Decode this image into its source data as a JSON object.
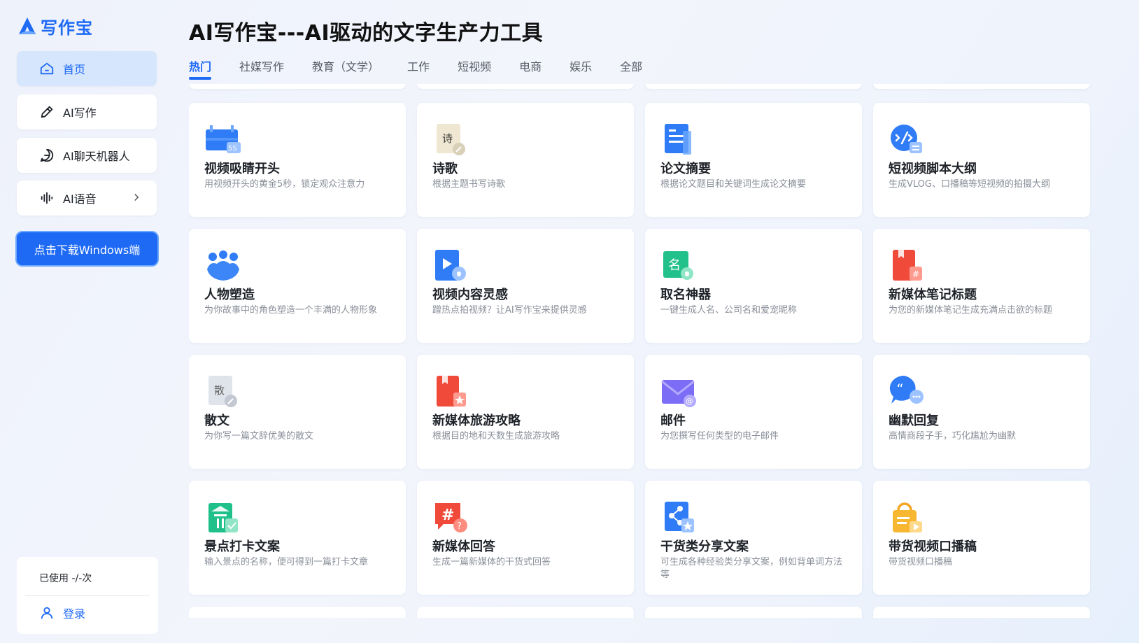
{
  "app": {
    "logo_text": "写作宝"
  },
  "sidebar": {
    "items": [
      {
        "label": "首页",
        "icon": "home-icon"
      },
      {
        "label": "AI写作",
        "icon": "pen-icon"
      },
      {
        "label": "AI聊天机器人",
        "icon": "chat-icon"
      },
      {
        "label": "AI语音",
        "icon": "audio-wave-icon"
      }
    ],
    "download_label": "点击下载Windows端",
    "usage_text": "已使用 -/-次",
    "login_label": "登录"
  },
  "header": {
    "title": "AI写作宝---AI驱动的文字生产力工具",
    "tabs": [
      "热门",
      "社媒写作",
      "教育（文学）",
      "工作",
      "短视频",
      "电商",
      "娱乐",
      "全部"
    ]
  },
  "cards": [
    {
      "title": "视频吸睛开头",
      "desc": "用视频开头的黄金5秒，锁定观众注意力",
      "icon": "video-5s-icon",
      "badge": "5S"
    },
    {
      "title": "诗歌",
      "desc": "根据主题书写诗歌",
      "icon": "poem-icon",
      "badge": "诗"
    },
    {
      "title": "论文摘要",
      "desc": "根据论文题目和关键词生成论文摘要",
      "icon": "document-icon"
    },
    {
      "title": "短视频脚本大纲",
      "desc": "生成VLOG、口播稿等短视频的拍摄大纲",
      "icon": "code-script-icon"
    },
    {
      "title": "人物塑造",
      "desc": "为你故事中的角色塑造一个丰满的人物形象",
      "icon": "people-icon"
    },
    {
      "title": "视频内容灵感",
      "desc": "蹭热点拍视频？让AI写作宝来提供灵感",
      "icon": "video-idea-icon"
    },
    {
      "title": "取名神器",
      "desc": "一键生成人名、公司名和爱宠昵称",
      "icon": "naming-icon",
      "badge": "名"
    },
    {
      "title": "新媒体笔记标题",
      "desc": "为您的新媒体笔记生成充满点击欲的标题",
      "icon": "note-hashtag-icon"
    },
    {
      "title": "散文",
      "desc": "为你写一篇文辞优美的散文",
      "icon": "prose-icon",
      "badge": "散"
    },
    {
      "title": "新媒体旅游攻略",
      "desc": "根据目的地和天数生成旅游攻略",
      "icon": "travel-book-icon"
    },
    {
      "title": "邮件",
      "desc": "为您撰写任何类型的电子邮件",
      "icon": "mail-icon"
    },
    {
      "title": "幽默回复",
      "desc": "高情商段子手，巧化尴尬为幽默",
      "icon": "quote-bubble-icon"
    },
    {
      "title": "景点打卡文案",
      "desc": "输入景点的名称，便可得到一篇打卡文章",
      "icon": "scenic-checkin-icon"
    },
    {
      "title": "新媒体回答",
      "desc": "生成一篇新媒体的干货式回答",
      "icon": "hashtag-question-icon"
    },
    {
      "title": "干货类分享文案",
      "desc": "可生成各种经验类分享文案，例如背单词方法等",
      "icon": "share-icon"
    },
    {
      "title": "带货视频口播稿",
      "desc": "带货视频口播稿",
      "icon": "shopping-bag-icon"
    }
  ],
  "colors": {
    "accent": "#1e6af5",
    "active_bg": "#d6e6fc"
  }
}
